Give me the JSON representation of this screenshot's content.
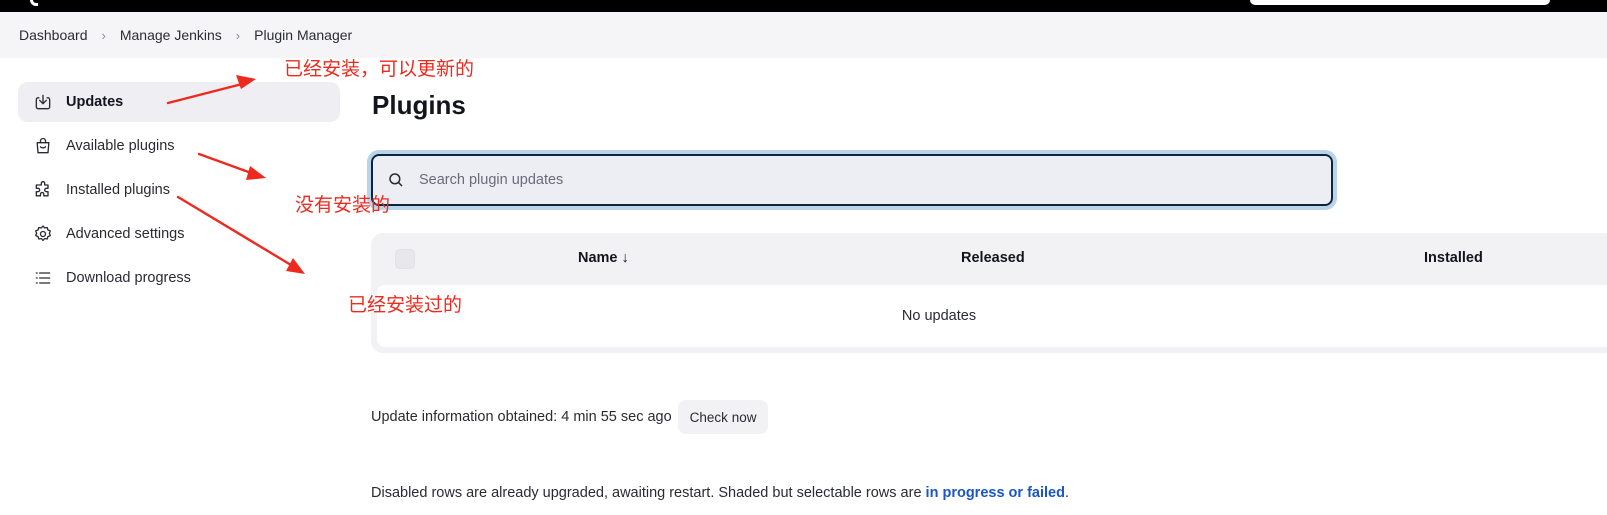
{
  "breadcrumbs": {
    "items": [
      "Dashboard",
      "Manage Jenkins",
      "Plugin Manager"
    ],
    "separator_icon": "chevron-right-icon"
  },
  "sidebar": {
    "items": [
      {
        "label": "Updates",
        "icon": "download-icon",
        "active": true
      },
      {
        "label": "Available plugins",
        "icon": "shopping-bag-icon",
        "active": false
      },
      {
        "label": "Installed plugins",
        "icon": "puzzle-icon",
        "active": false
      },
      {
        "label": "Advanced settings",
        "icon": "gear-icon",
        "active": false
      },
      {
        "label": "Download progress",
        "icon": "list-icon",
        "active": false
      }
    ]
  },
  "main": {
    "title": "Plugins",
    "search": {
      "placeholder": "Search plugin updates",
      "value": ""
    },
    "table": {
      "columns": [
        "Name ↓",
        "Released",
        "Installed"
      ],
      "empty_text": "No updates"
    },
    "update_info": "Update information obtained: 4 min 55 sec ago",
    "check_now_label": "Check now",
    "footer_text": "Disabled rows are already upgraded, awaiting restart. Shaded but selectable rows are ",
    "footer_link": "in progress or failed",
    "footer_end": "."
  },
  "annotations": {
    "updates": "已经安装，可以更新的",
    "available": "没有安装的",
    "installed": "已经安装过的",
    "color": "#ee2a1f"
  },
  "colors": {
    "accent_link": "#1a56c9",
    "search_border": "#0c2440",
    "search_focus_ring": "#b9d4ea"
  }
}
